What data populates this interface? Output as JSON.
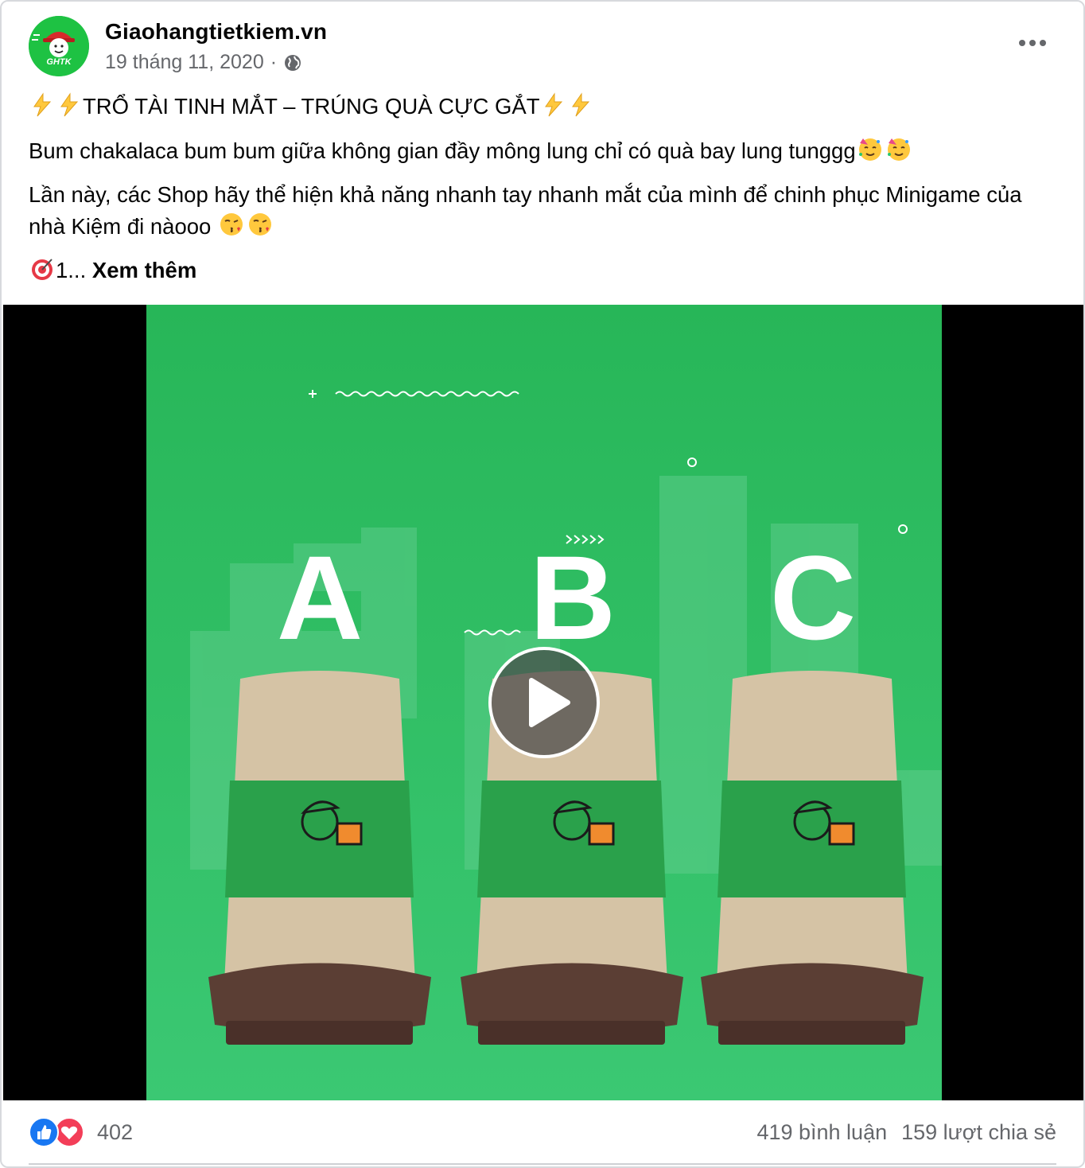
{
  "post": {
    "page_name": "Giaohangtietkiem.vn",
    "date": "19 tháng 11, 2020",
    "separator": "·",
    "avatar_text": "GHTK",
    "headline": "TRỔ TÀI TINH MẮT – TRÚNG QUÀ CỰC GẮT",
    "paragraph_1": "Bum chakalaca bum bum giữa không gian đầy mông lung chỉ có quà bay lung tunggg",
    "paragraph_2": "Lần này, các Shop hãy thể hiện khả năng nhanh tay nhanh mắt của mình để chinh phục Minigame của nhà Kiệm đi nàooo",
    "teaser_prefix": "1...",
    "see_more": "Xem thêm"
  },
  "video": {
    "letters": [
      "A",
      "B",
      "C"
    ],
    "background_color": "#2cbd5e"
  },
  "footer": {
    "reaction_count": "402",
    "comments": "419 bình luận",
    "shares": "159 lượt chia sẻ"
  },
  "icons": [
    "lightning-icon",
    "party-face-icon",
    "kiss-face-icon",
    "target-icon",
    "globe-icon",
    "more-icon",
    "play-icon",
    "like-icon",
    "love-icon"
  ]
}
